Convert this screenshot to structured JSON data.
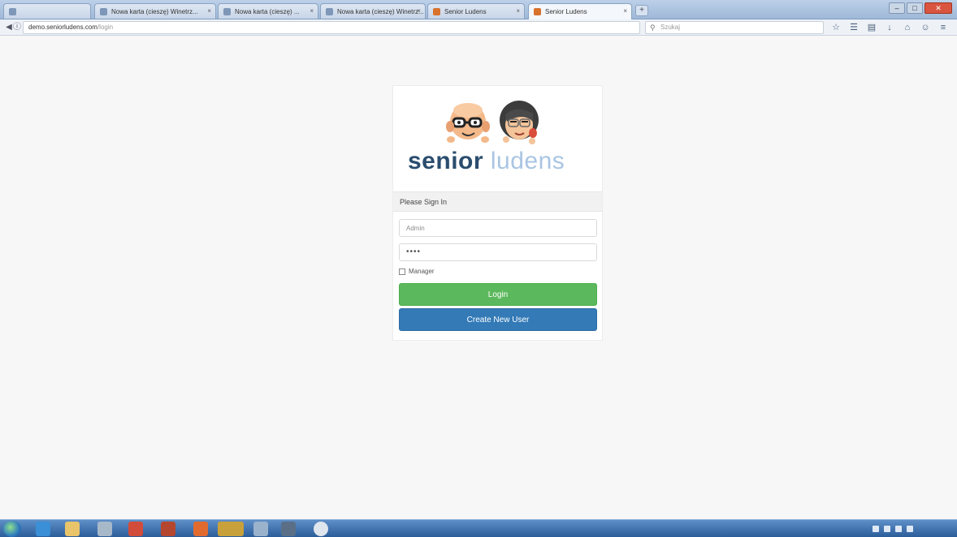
{
  "browser": {
    "tabs": [
      {
        "label": "",
        "active": false
      },
      {
        "label": "Nowa karta (cieszę) Winetrz...",
        "active": false
      },
      {
        "label": "Nowa karta (cieszę) ...",
        "active": false
      },
      {
        "label": "Nowa karta (cieszę) Winetrz...",
        "active": false
      },
      {
        "label": "Senior Ludens",
        "active": false
      },
      {
        "label": "Senior Ludens",
        "active": true
      }
    ],
    "new_tab": "+",
    "url_host": "demo.seniorludens.com",
    "url_path": "/login",
    "search_placeholder": "Szukaj"
  },
  "login": {
    "brand_bold": "senior",
    "brand_light": "ludens",
    "heading": "Please Sign In",
    "username_placeholder": "Admin",
    "password_value": "••••",
    "remember_label": "Manager",
    "login_label": "Login",
    "create_label": "Create New User"
  },
  "colors": {
    "login_green": "#5cb85c",
    "create_blue": "#337ab7",
    "brand_dark": "#2a4d6e",
    "brand_light": "#a9c5e3"
  }
}
